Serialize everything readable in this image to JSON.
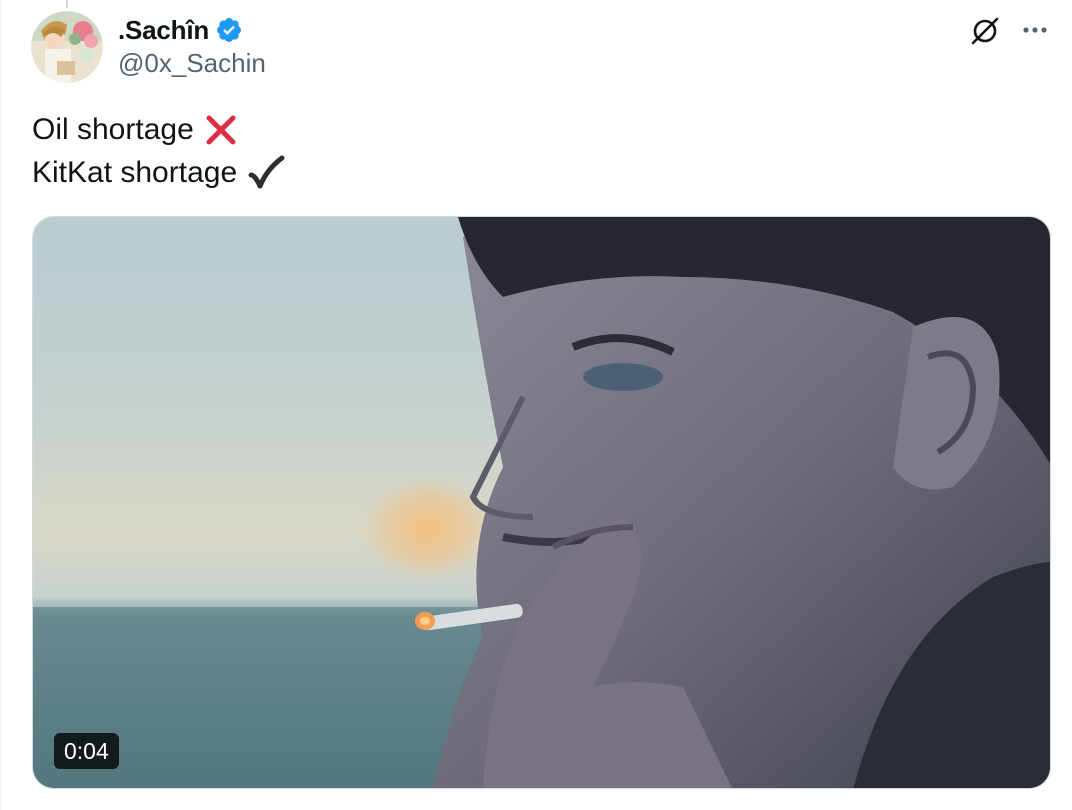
{
  "author": {
    "display_name": ".Sachîn",
    "handle": "@0x_Sachin",
    "verified": true,
    "verified_color": "#1d9bf0"
  },
  "tweet": {
    "lines": [
      {
        "text": "Oil shortage",
        "emoji": "cross-mark-icon",
        "emoji_color": "#dd2e44"
      },
      {
        "text": "KitKat shortage",
        "emoji": "check-mark-icon",
        "emoji_color": "#292f33"
      }
    ]
  },
  "media": {
    "type": "video",
    "duration": "0:04"
  },
  "actions": {
    "grok_icon": "grok-icon",
    "more_icon": "more-icon"
  },
  "colors": {
    "text_primary": "#0f1419",
    "text_secondary": "#536471",
    "border": "#cfd9de"
  }
}
